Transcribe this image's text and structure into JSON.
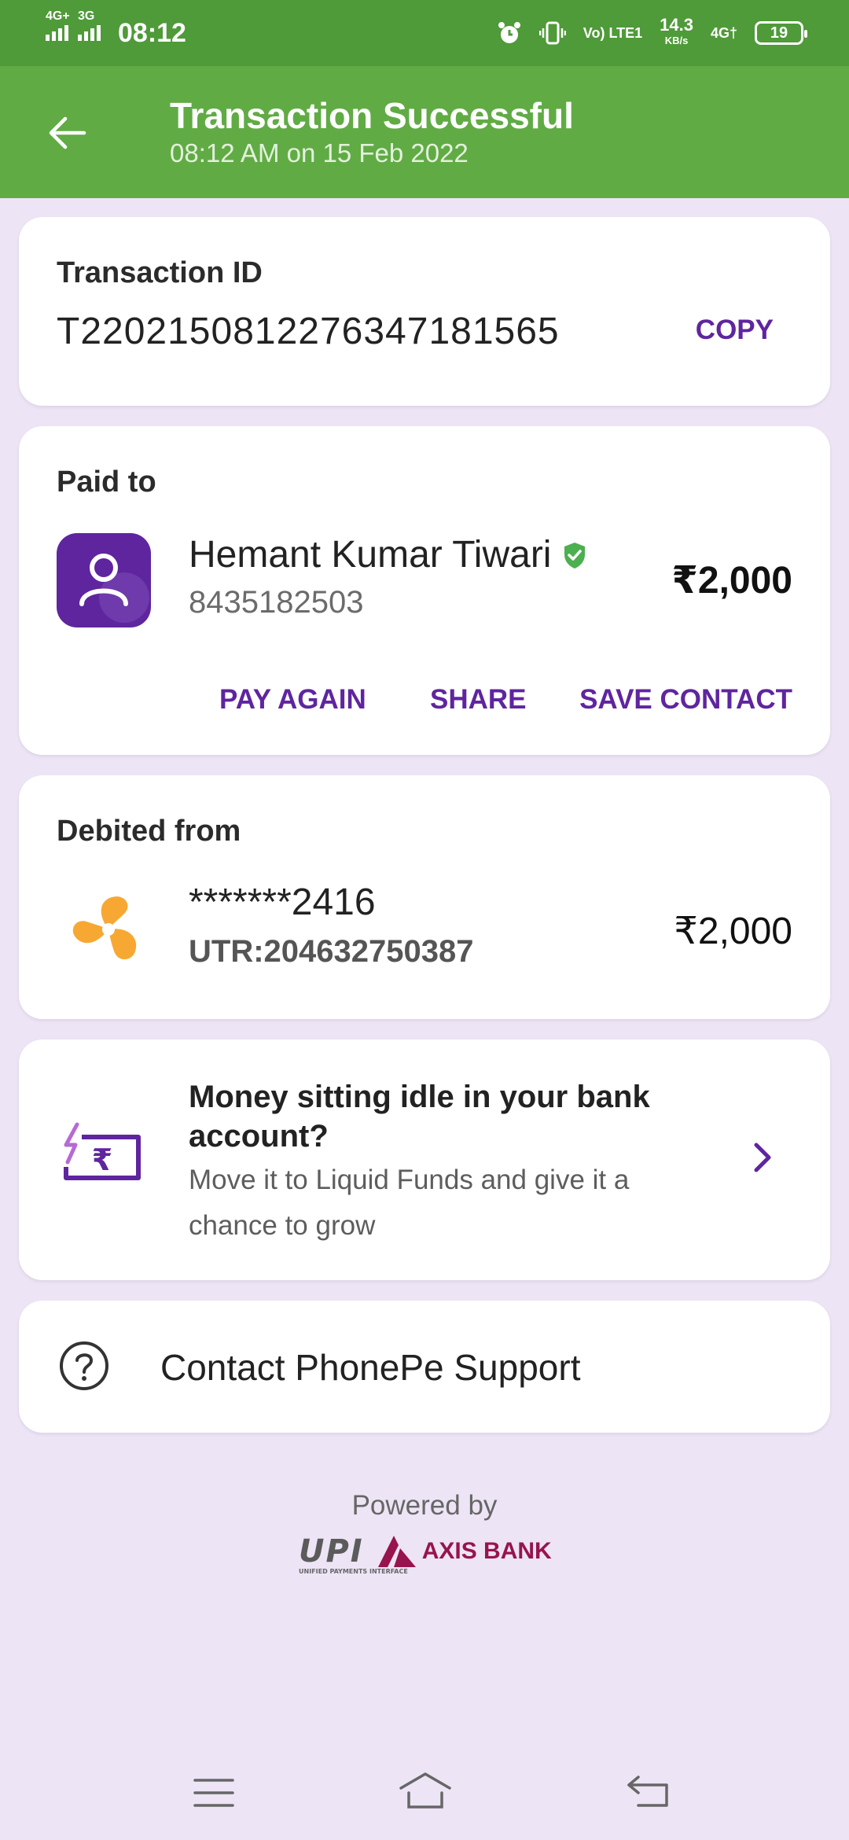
{
  "status_bar": {
    "sim1": "4G+",
    "sim2": "3G",
    "time": "08:12",
    "volte": "Vo) LTE1",
    "speed_value": "14.3",
    "speed_unit": "KB/s",
    "net": "4G†",
    "battery": "19"
  },
  "header": {
    "title": "Transaction Successful",
    "subtitle": "08:12 AM on 15 Feb 2022"
  },
  "transaction": {
    "label": "Transaction ID",
    "id": "T2202150812276347181565",
    "copy_label": "COPY"
  },
  "paid_to": {
    "label": "Paid to",
    "name": "Hemant Kumar Tiwari",
    "phone": "8435182503",
    "amount": "₹2,000",
    "actions": [
      "PAY AGAIN",
      "SHARE",
      "SAVE CONTACT"
    ]
  },
  "debited_from": {
    "label": "Debited from",
    "account": "*******2416",
    "utr": "UTR:204632750387",
    "amount": "₹2,000"
  },
  "promo": {
    "title": "Money sitting idle in your bank account?",
    "description": "Move it to Liquid Funds and give it a chance to grow"
  },
  "support": {
    "label": "Contact PhonePe Support"
  },
  "footer": {
    "powered_by": "Powered by",
    "upi_text": "UPI",
    "upi_tagline": "UNIFIED PAYMENTS INTERFACE",
    "bank_text": "AXIS BANK"
  },
  "colors": {
    "header_green": "#61ab45",
    "status_green": "#4f9a39",
    "brand_purple": "#5f259f",
    "background": "#ede4f6",
    "verified_green": "#4caf50",
    "bank_orange": "#f7a833"
  },
  "icons": {
    "back": "arrow-left-icon",
    "verified": "verified-shield-icon",
    "bank": "icici-bank-icon",
    "promo": "rupee-wallet-icon",
    "chevron": "chevron-right-icon",
    "help": "question-circle-icon"
  }
}
